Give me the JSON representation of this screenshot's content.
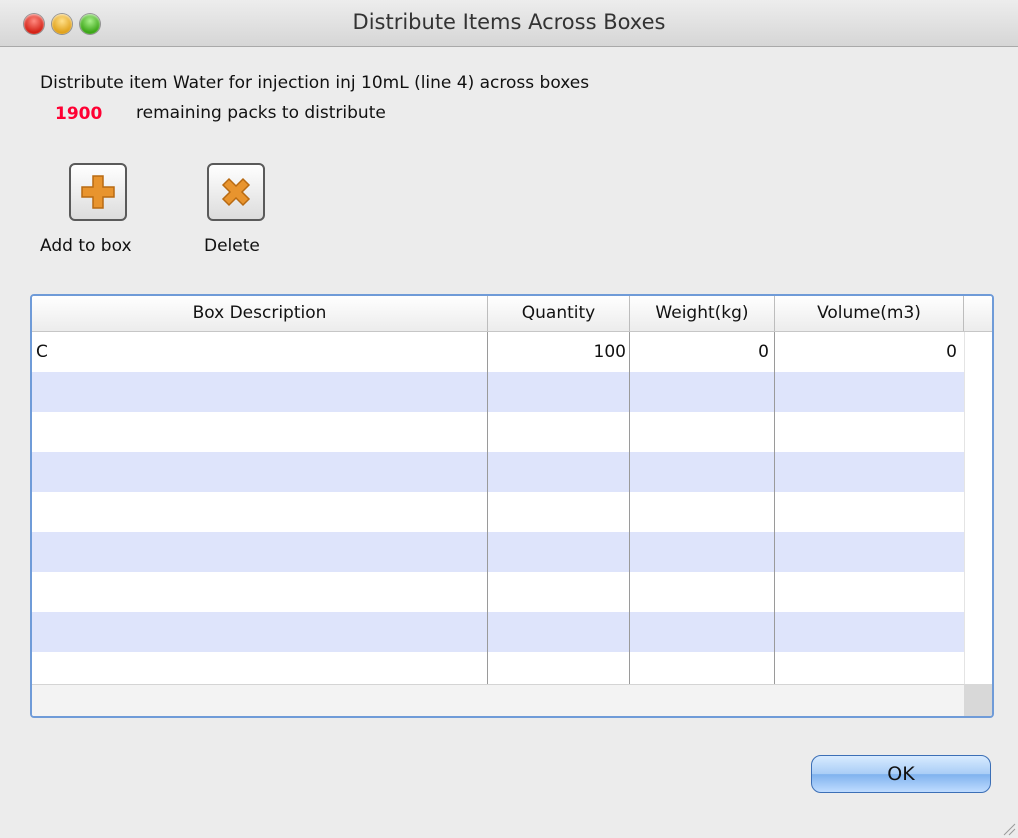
{
  "window": {
    "title": "Distribute Items Across Boxes"
  },
  "info": {
    "description": "Distribute item Water for injection inj 10mL (line 4) across boxes",
    "remaining_count": "1900",
    "remaining_label": "remaining packs to distribute"
  },
  "toolbar": {
    "add_label": "Add to box",
    "add_icon": "plus-icon",
    "delete_label": "Delete",
    "delete_icon": "x-icon",
    "icon_color": "#e8942e"
  },
  "table": {
    "columns": [
      "Box Description",
      "Quantity",
      "Weight(kg)",
      "Volume(m3)"
    ],
    "rows": [
      {
        "box_description": "C",
        "quantity": "100",
        "weight": "0",
        "volume": "0"
      }
    ],
    "stripe_color": "#dee4fb"
  },
  "footer": {
    "ok_label": "OK"
  },
  "colors": {
    "remaining": "#ff0033",
    "accent": "#6f9bd8"
  }
}
